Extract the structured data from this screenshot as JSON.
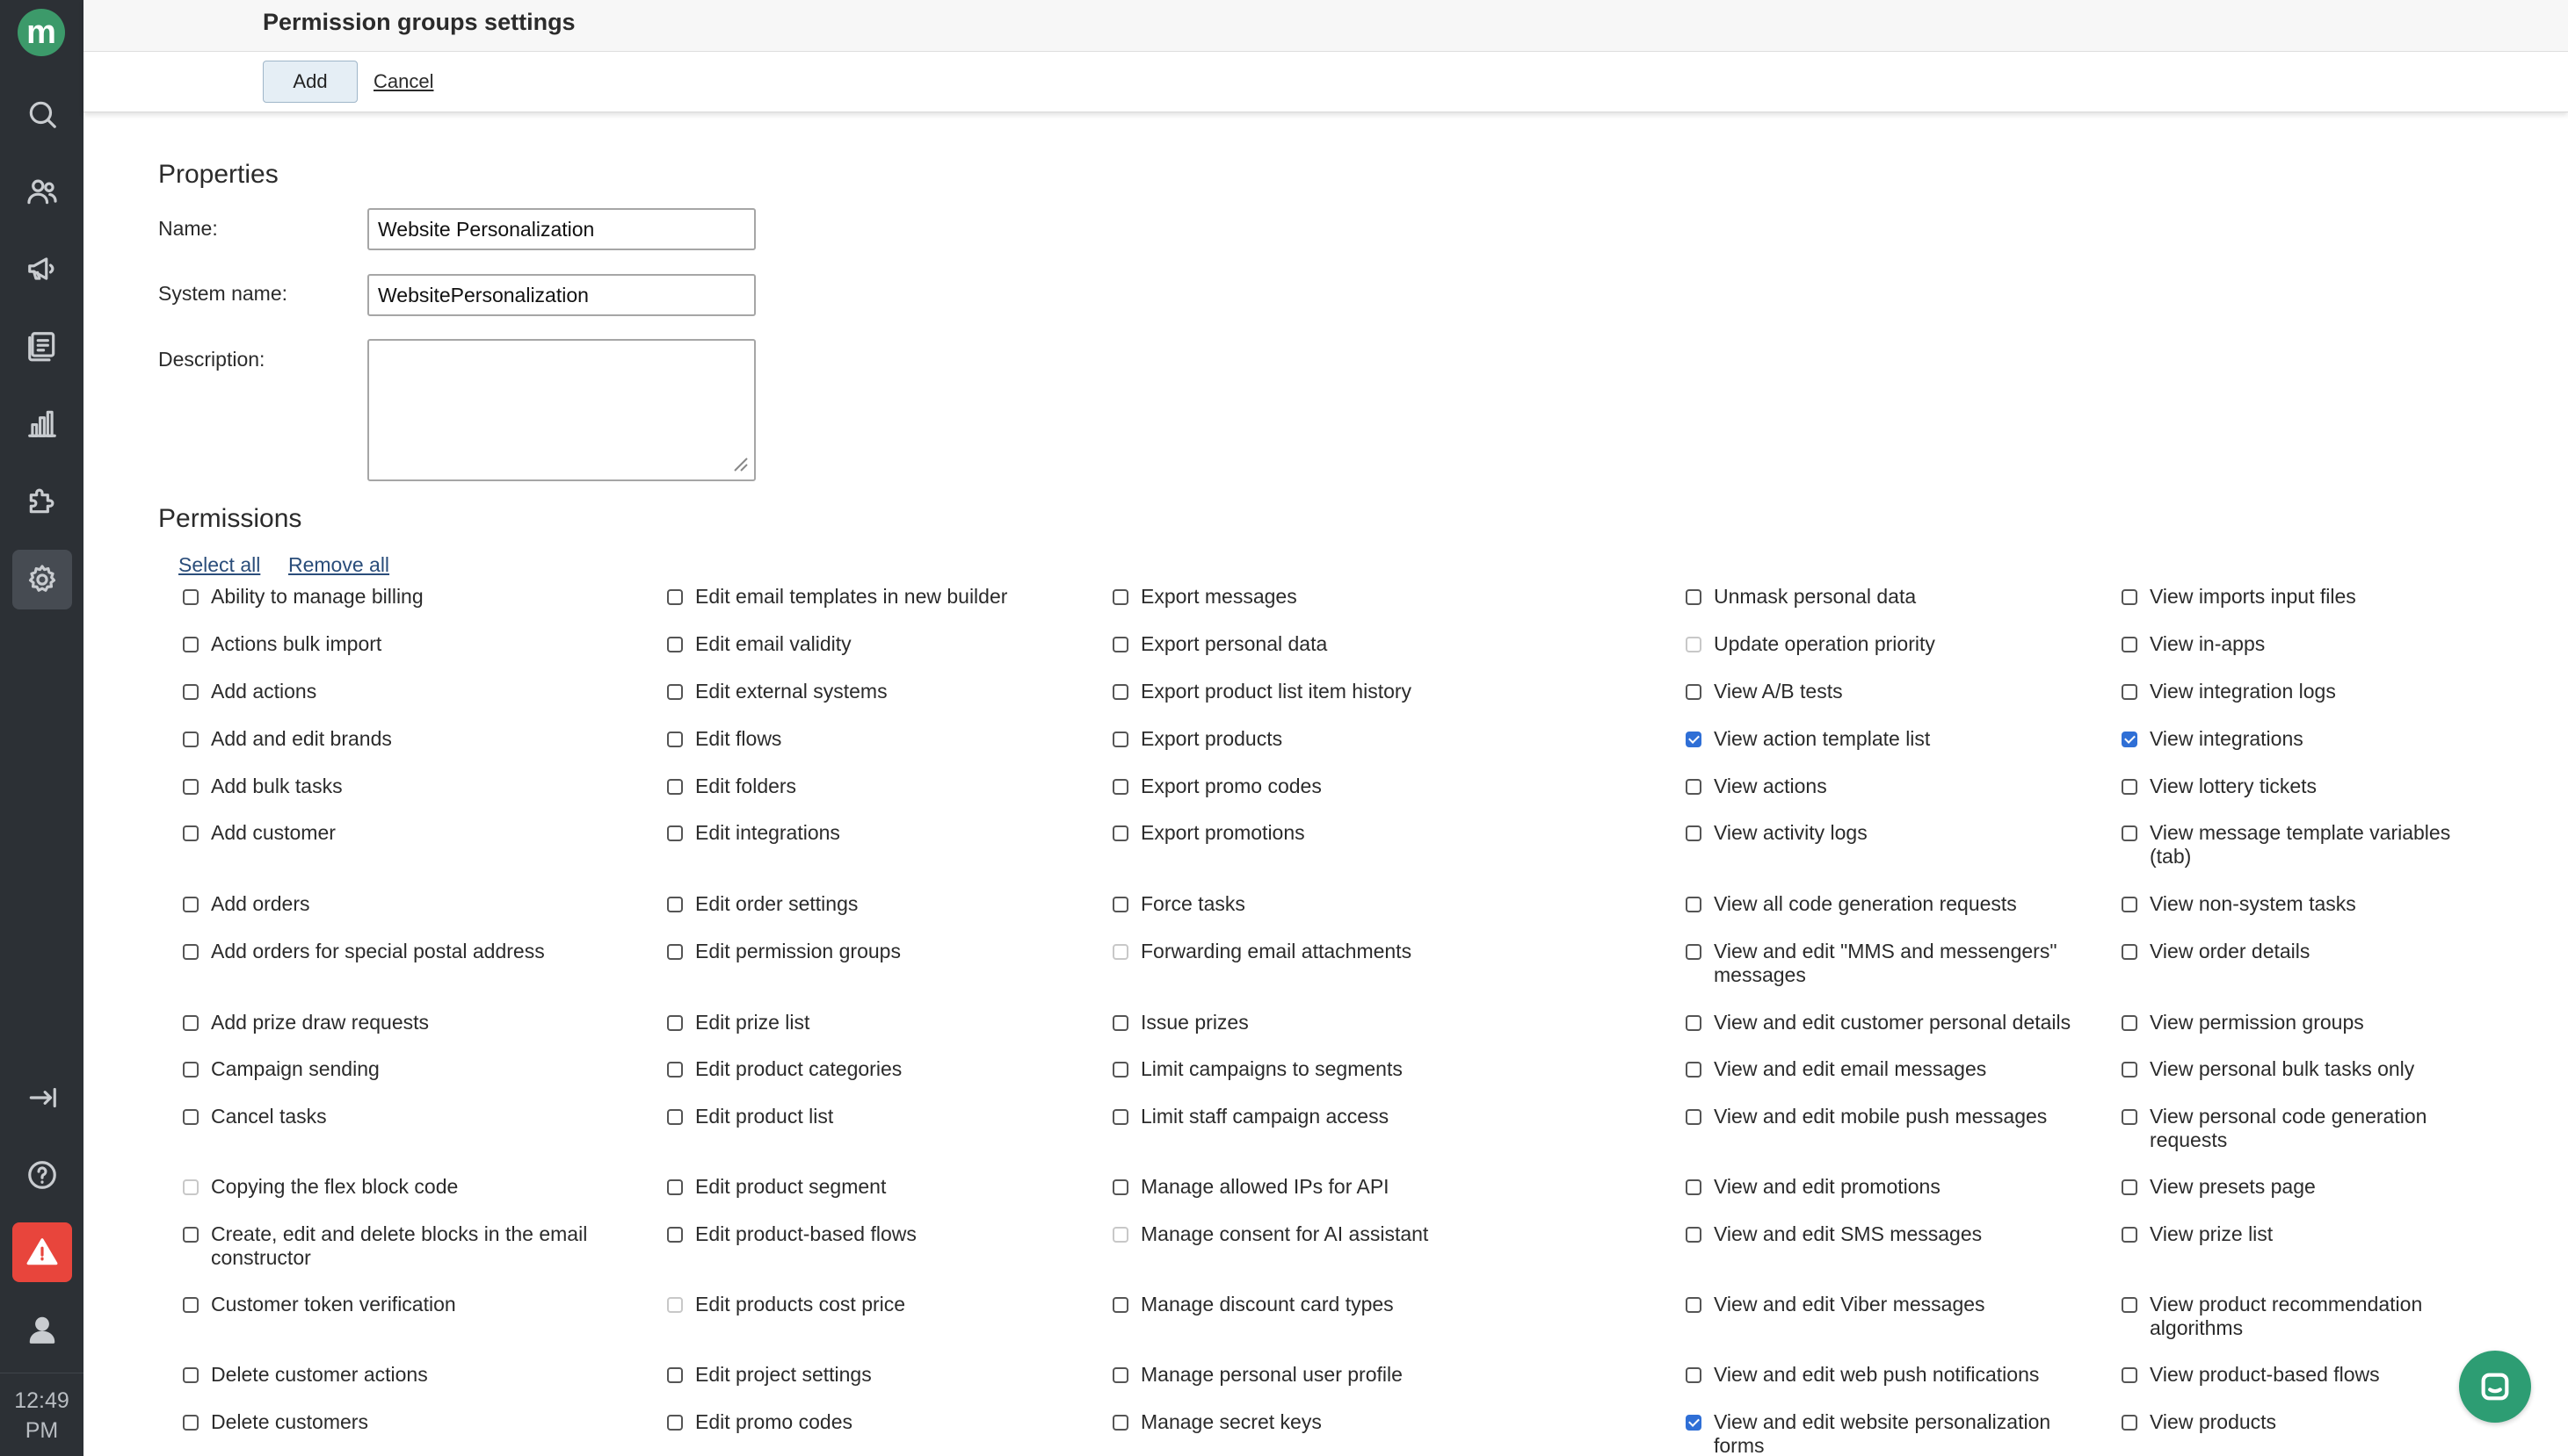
{
  "sidebar": {
    "logo_letter": "m",
    "nav": [
      {
        "name": "search",
        "icon": "search-icon"
      },
      {
        "name": "customers",
        "icon": "users-icon"
      },
      {
        "name": "campaigns",
        "icon": "megaphone-icon"
      },
      {
        "name": "content",
        "icon": "documents-icon"
      },
      {
        "name": "analytics",
        "icon": "bar-chart-icon"
      },
      {
        "name": "integrations",
        "icon": "puzzle-icon"
      },
      {
        "name": "settings",
        "icon": "gear-icon",
        "active": true
      }
    ],
    "bottom": [
      {
        "name": "logout",
        "icon": "exit-icon"
      },
      {
        "name": "help",
        "icon": "help-icon"
      },
      {
        "name": "alerts",
        "icon": "warning-icon"
      },
      {
        "name": "profile",
        "icon": "user-icon"
      }
    ],
    "clock_line1": "12:49",
    "clock_line2": "PM"
  },
  "header": {
    "title": "Permission groups settings",
    "add_label": "Add",
    "cancel_label": "Cancel"
  },
  "properties": {
    "title": "Properties",
    "name_label": "Name:",
    "name_value": "Website Personalization",
    "system_name_label": "System name:",
    "system_name_value": "WebsitePersonalization",
    "description_label": "Description:",
    "description_value": ""
  },
  "permissions": {
    "title": "Permissions",
    "select_all": "Select all",
    "remove_all": "Remove all",
    "columns": [
      [
        {
          "label": "Ability to manage billing",
          "checked": false
        },
        {
          "label": "Actions bulk import",
          "checked": false
        },
        {
          "label": "Add actions",
          "checked": false
        },
        {
          "label": "Add and edit brands",
          "checked": false
        },
        {
          "label": "Add bulk tasks",
          "checked": false
        },
        {
          "label": "Add customer",
          "checked": false
        },
        {
          "label": "Add orders",
          "checked": false
        },
        {
          "label": "Add orders for special postal address",
          "checked": false
        },
        {
          "label": "Add prize draw requests",
          "checked": false
        },
        {
          "label": "Campaign sending",
          "checked": false
        },
        {
          "label": "Cancel tasks",
          "checked": false
        },
        {
          "label": "Copying the flex block code",
          "checked": false,
          "disabled": true
        },
        {
          "label": "Create, edit and delete blocks in the email constructor",
          "checked": false
        },
        {
          "label": "Customer token verification",
          "checked": false
        },
        {
          "label": "Delete customer actions",
          "checked": false
        },
        {
          "label": "Delete customers",
          "checked": false
        }
      ],
      [
        {
          "label": "Edit email templates in new builder",
          "checked": false
        },
        {
          "label": "Edit email validity",
          "checked": false
        },
        {
          "label": "Edit external systems",
          "checked": false
        },
        {
          "label": "Edit flows",
          "checked": false
        },
        {
          "label": "Edit folders",
          "checked": false
        },
        {
          "label": "Edit integrations",
          "checked": false
        },
        {
          "label": "Edit order settings",
          "checked": false
        },
        {
          "label": "Edit permission groups",
          "checked": false
        },
        {
          "label": "Edit prize list",
          "checked": false
        },
        {
          "label": "Edit product categories",
          "checked": false
        },
        {
          "label": "Edit product list",
          "checked": false
        },
        {
          "label": "Edit product segment",
          "checked": false
        },
        {
          "label": "Edit product-based flows",
          "checked": false
        },
        {
          "label": "Edit products cost price",
          "checked": false,
          "disabled": true
        },
        {
          "label": "Edit project settings",
          "checked": false
        },
        {
          "label": "Edit promo codes",
          "checked": false
        }
      ],
      [
        {
          "label": "Export messages",
          "checked": false
        },
        {
          "label": "Export personal data",
          "checked": false
        },
        {
          "label": "Export product list item history",
          "checked": false
        },
        {
          "label": "Export products",
          "checked": false
        },
        {
          "label": "Export promo codes",
          "checked": false
        },
        {
          "label": "Export promotions",
          "checked": false
        },
        {
          "label": "Force tasks",
          "checked": false
        },
        {
          "label": "Forwarding email attachments",
          "checked": false,
          "disabled": true
        },
        {
          "label": "Issue prizes",
          "checked": false
        },
        {
          "label": "Limit campaigns to segments",
          "checked": false
        },
        {
          "label": "Limit staff campaign access",
          "checked": false
        },
        {
          "label": "Manage allowed IPs for API",
          "checked": false
        },
        {
          "label": "Manage consent for AI assistant",
          "checked": false,
          "disabled": true
        },
        {
          "label": "Manage discount card types",
          "checked": false
        },
        {
          "label": "Manage personal user profile",
          "checked": false
        },
        {
          "label": "Manage secret keys",
          "checked": false
        }
      ],
      [
        {
          "label": "Unmask personal data",
          "checked": false
        },
        {
          "label": "Update operation priority",
          "checked": false,
          "disabled": true
        },
        {
          "label": "View A/B tests",
          "checked": false
        },
        {
          "label": "View action template list",
          "checked": true
        },
        {
          "label": "View actions",
          "checked": false
        },
        {
          "label": "View activity logs",
          "checked": false
        },
        {
          "label": "View all code generation requests",
          "checked": false
        },
        {
          "label": "View and edit \"MMS and messengers\" messages",
          "checked": false
        },
        {
          "label": "View and edit customer personal details",
          "checked": false
        },
        {
          "label": "View and edit email messages",
          "checked": false
        },
        {
          "label": "View and edit mobile push messages",
          "checked": false
        },
        {
          "label": "View and edit promotions",
          "checked": false
        },
        {
          "label": "View and edit SMS messages",
          "checked": false
        },
        {
          "label": "View and edit Viber messages",
          "checked": false
        },
        {
          "label": "View and edit web push notifications",
          "checked": false
        },
        {
          "label": "View and edit website personalization forms",
          "checked": true
        }
      ],
      [
        {
          "label": "View imports input files",
          "checked": false
        },
        {
          "label": "View in-apps",
          "checked": false
        },
        {
          "label": "View integration logs",
          "checked": false
        },
        {
          "label": "View integrations",
          "checked": true
        },
        {
          "label": "View lottery tickets",
          "checked": false
        },
        {
          "label": "View message template variables (tab)",
          "checked": false
        },
        {
          "label": "View non-system tasks",
          "checked": false
        },
        {
          "label": "View order details",
          "checked": false
        },
        {
          "label": "View permission groups",
          "checked": false
        },
        {
          "label": "View personal bulk tasks only",
          "checked": false
        },
        {
          "label": "View personal code generation requests",
          "checked": false
        },
        {
          "label": "View presets page",
          "checked": false
        },
        {
          "label": "View prize list",
          "checked": false
        },
        {
          "label": "View product recommendation algorithms",
          "checked": false
        },
        {
          "label": "View product-based flows",
          "checked": false
        },
        {
          "label": "View products",
          "checked": false
        }
      ]
    ]
  },
  "chat": {
    "icon": "chat-icon"
  }
}
